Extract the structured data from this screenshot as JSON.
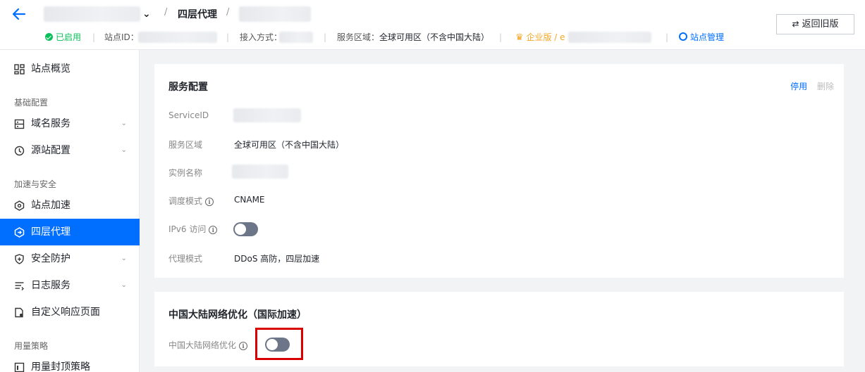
{
  "header": {
    "breadcrumb_sep": "/",
    "page_title": "四层代理",
    "status": "已启用",
    "site_id_label": "站点ID：",
    "access_label": "接入方式：",
    "region_label": "服务区域：",
    "region_value": "全球可用区（不含中国大陆）",
    "plan_label": "企业版 / e",
    "site_manage": "站点管理",
    "revert_button": "返回旧版",
    "meta_sep": "|"
  },
  "sidebar": {
    "overview": "站点概览",
    "group_basic": "基础配置",
    "domain_service": "域名服务",
    "origin_config": "源站配置",
    "group_accel": "加速与安全",
    "site_accel": "站点加速",
    "l4_proxy": "四层代理",
    "security": "安全防护",
    "log_service": "日志服务",
    "custom_page": "自定义响应页面",
    "group_usage": "用量策略",
    "usage_cap": "用量封顶策略"
  },
  "service_config": {
    "title": "服务配置",
    "action_disable": "停用",
    "action_delete": "删除",
    "service_id_label": "ServiceID",
    "region_label": "服务区域",
    "region_value": "全球可用区（不含中国大陆）",
    "instance_label": "实例名称",
    "schedule_label": "调度模式",
    "schedule_value": "CNAME",
    "ipv6_label": "IPv6 访问",
    "ipv6_enabled": false,
    "proxy_mode_label": "代理模式",
    "proxy_mode_value": "DDoS 高防，四层加速"
  },
  "mainland_opt": {
    "title": "中国大陆网络优化（国际加速）",
    "label": "中国大陆网络优化",
    "enabled": false
  },
  "colors": {
    "accent": "#006eff",
    "success": "#0abf5b",
    "toggle_off": "#6d7688",
    "highlight": "#d90000"
  }
}
